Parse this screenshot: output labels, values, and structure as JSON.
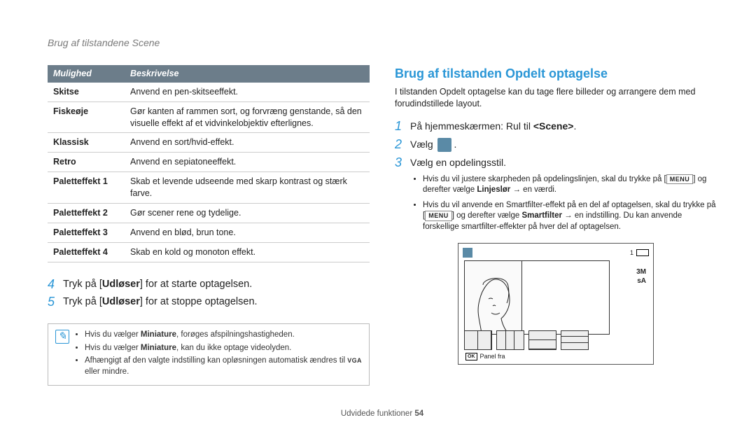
{
  "page_header": "Brug af tilstandene Scene",
  "table": {
    "header_option": "Mulighed",
    "header_desc": "Beskrivelse",
    "rows": [
      {
        "opt": "Skitse",
        "desc": "Anvend en pen-skitseeffekt."
      },
      {
        "opt": "Fiskeøje",
        "desc": "Gør kanten af rammen sort, og forvræng genstande, så den visuelle effekt af et vidvinkelobjektiv efterlignes."
      },
      {
        "opt": "Klassisk",
        "desc": "Anvend en sort/hvid-effekt."
      },
      {
        "opt": "Retro",
        "desc": "Anvend en sepiatoneeffekt."
      },
      {
        "opt": "Paletteffekt 1",
        "desc": "Skab et levende udseende med skarp kontrast og stærk farve."
      },
      {
        "opt": "Paletteffekt 2",
        "desc": "Gør scener rene og tydelige."
      },
      {
        "opt": "Paletteffekt 3",
        "desc": "Anvend en blød, brun tone."
      },
      {
        "opt": "Paletteffekt 4",
        "desc": "Skab en kold og monoton effekt."
      }
    ]
  },
  "left_steps": {
    "step4_num": "4",
    "step4_text_a": "Tryk på [",
    "step4_bold": "Udløser",
    "step4_text_b": "] for at starte optagelsen.",
    "step5_num": "5",
    "step5_text_a": "Tryk på [",
    "step5_bold": "Udløser",
    "step5_text_b": "] for at stoppe optagelsen."
  },
  "note": {
    "bullets": [
      {
        "pre": "Hvis du vælger ",
        "bold": "Miniature",
        "post": ", forøges afspilningshastigheden."
      },
      {
        "pre": "Hvis du vælger ",
        "bold": "Miniature",
        "post": ", kan du ikke optage videolyden."
      }
    ],
    "bullet3_pre": "Afhængigt af den valgte indstilling kan opløsningen automatisk ændres til ",
    "bullet3_tag": "VGA",
    "bullet3_post": " eller mindre."
  },
  "right": {
    "title": "Brug af tilstanden Opdelt optagelse",
    "intro": "I tilstanden Opdelt optagelse kan du tage flere billeder og arrangere dem med forudindstillede layout.",
    "step1_num": "1",
    "step1_pre": "På hjemmeskærmen: Rul til ",
    "step1_bold": "<Scene>",
    "step1_post": ".",
    "step2_num": "2",
    "step2_text": "Vælg ",
    "step2_post": ".",
    "step3_num": "3",
    "step3_text": "Vælg en opdelingsstil.",
    "sub_bullets": {
      "b1_pre": "Hvis du vil justere skarpheden på opdelingslinjen, skal du trykke på [",
      "b1_menu": "MENU",
      "b1_mid": "] og derefter vælge ",
      "b1_bold": "Linjeslør",
      "b1_post": " → en værdi.",
      "b2_pre": "Hvis du vil anvende en Smartfilter-effekt på en del af optagelsen, skal du trykke på [",
      "b2_menu": "MENU",
      "b2_mid": "] og derefter vælge ",
      "b2_bold": "Smartfilter",
      "b2_post": " → en indstilling. Du kan anvende forskellige smartfilter-effekter på hver del af optagelsen."
    }
  },
  "lcd": {
    "top_right_1": "1",
    "right_label_1": "3M",
    "right_label_2": "sA",
    "ok": "OK",
    "caption": "Panel fra"
  },
  "footer_section": "Udvidede funktioner ",
  "footer_page": "54"
}
